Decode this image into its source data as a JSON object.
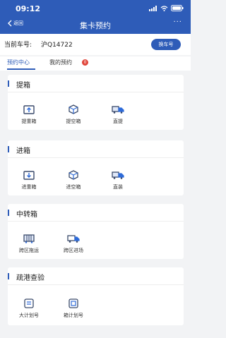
{
  "status_bar": {
    "time": "09:12"
  },
  "nav": {
    "back_label": "返回",
    "title": "集卡预约",
    "more": "···"
  },
  "car": {
    "label": "当前车号:",
    "plate": "沪Q14722",
    "change_label": "换车号"
  },
  "tabs": [
    {
      "label": "预约中心",
      "active": true
    },
    {
      "label": "我的预约",
      "badge": "0"
    }
  ],
  "sections": [
    {
      "title": "提箱",
      "items": [
        {
          "label": "提重箱",
          "icon": "box-up-icon"
        },
        {
          "label": "提空箱",
          "icon": "empty-box-icon"
        },
        {
          "label": "直提",
          "icon": "truck-container-icon"
        }
      ]
    },
    {
      "title": "进箱",
      "items": [
        {
          "label": "进重箱",
          "icon": "box-down-icon"
        },
        {
          "label": "进空箱",
          "icon": "empty-box-icon"
        },
        {
          "label": "直装",
          "icon": "truck-container-icon"
        }
      ]
    },
    {
      "title": "中转箱",
      "items": [
        {
          "label": "跨区拖运",
          "icon": "tow-icon"
        },
        {
          "label": "跨区进场",
          "icon": "truck-enter-icon"
        }
      ]
    },
    {
      "title": "疏港查验",
      "items": [
        {
          "label": "大计划号",
          "icon": "plan-icon"
        },
        {
          "label": "箱计划号",
          "icon": "box-plan-icon"
        }
      ]
    }
  ],
  "colors": {
    "primary": "#2e5cb8",
    "badge": "#e0453a",
    "icon_dark": "#3a4a6b",
    "icon_accent": "#2e6bd9"
  }
}
